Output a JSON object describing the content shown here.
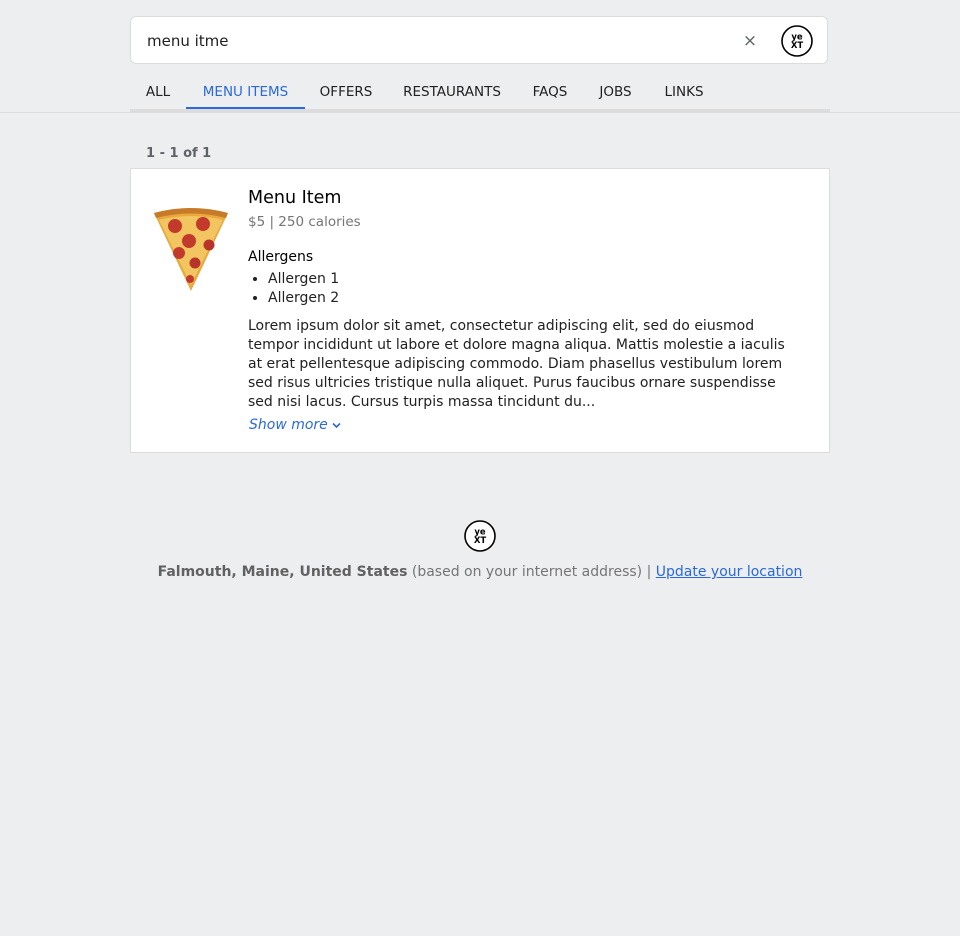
{
  "search": {
    "value": "menu itme",
    "clear_label": "×",
    "icons": {
      "clear": "close-icon",
      "submit": "yext-logo-icon"
    },
    "logo_text_top": "ye",
    "logo_text_bottom": "XT"
  },
  "tabs": [
    {
      "label": "ALL",
      "active": false
    },
    {
      "label": "MENU ITEMS",
      "active": true
    },
    {
      "label": "OFFERS",
      "active": false
    },
    {
      "label": "RESTAURANTS",
      "active": false
    },
    {
      "label": "FAQS",
      "active": false
    },
    {
      "label": "JOBS",
      "active": false
    },
    {
      "label": "LINKS",
      "active": false
    }
  ],
  "results": {
    "count_text": "1 - 1 of 1",
    "items": [
      {
        "title": "Menu Item",
        "subtitle": "$5 | 250 calories",
        "image_icon": "pizza-slice-icon",
        "allergens_heading": "Allergens",
        "allergens": [
          "Allergen 1",
          "Allergen 2"
        ],
        "description": "Lorem ipsum dolor sit amet, consectetur adipiscing elit, sed do eiusmod tempor incididunt ut labore et dolore magna aliqua. Mattis molestie a iaculis at erat pellentesque adipiscing commodo. Diam phasellus vestibulum lorem sed risus ultricies tristique nulla aliquet. Purus faucibus ornare suspendisse sed nisi lacus. Cursus turpis massa tincidunt du...",
        "show_more_label": "Show more"
      }
    ]
  },
  "footer": {
    "location": "Falmouth, Maine, United States",
    "basis": "(based on your internet address) |",
    "update_link": "Update your location"
  },
  "colors": {
    "accent": "#2b6ad6",
    "background": "#edeef0",
    "card": "#ffffff",
    "border": "#dcdcdc"
  }
}
